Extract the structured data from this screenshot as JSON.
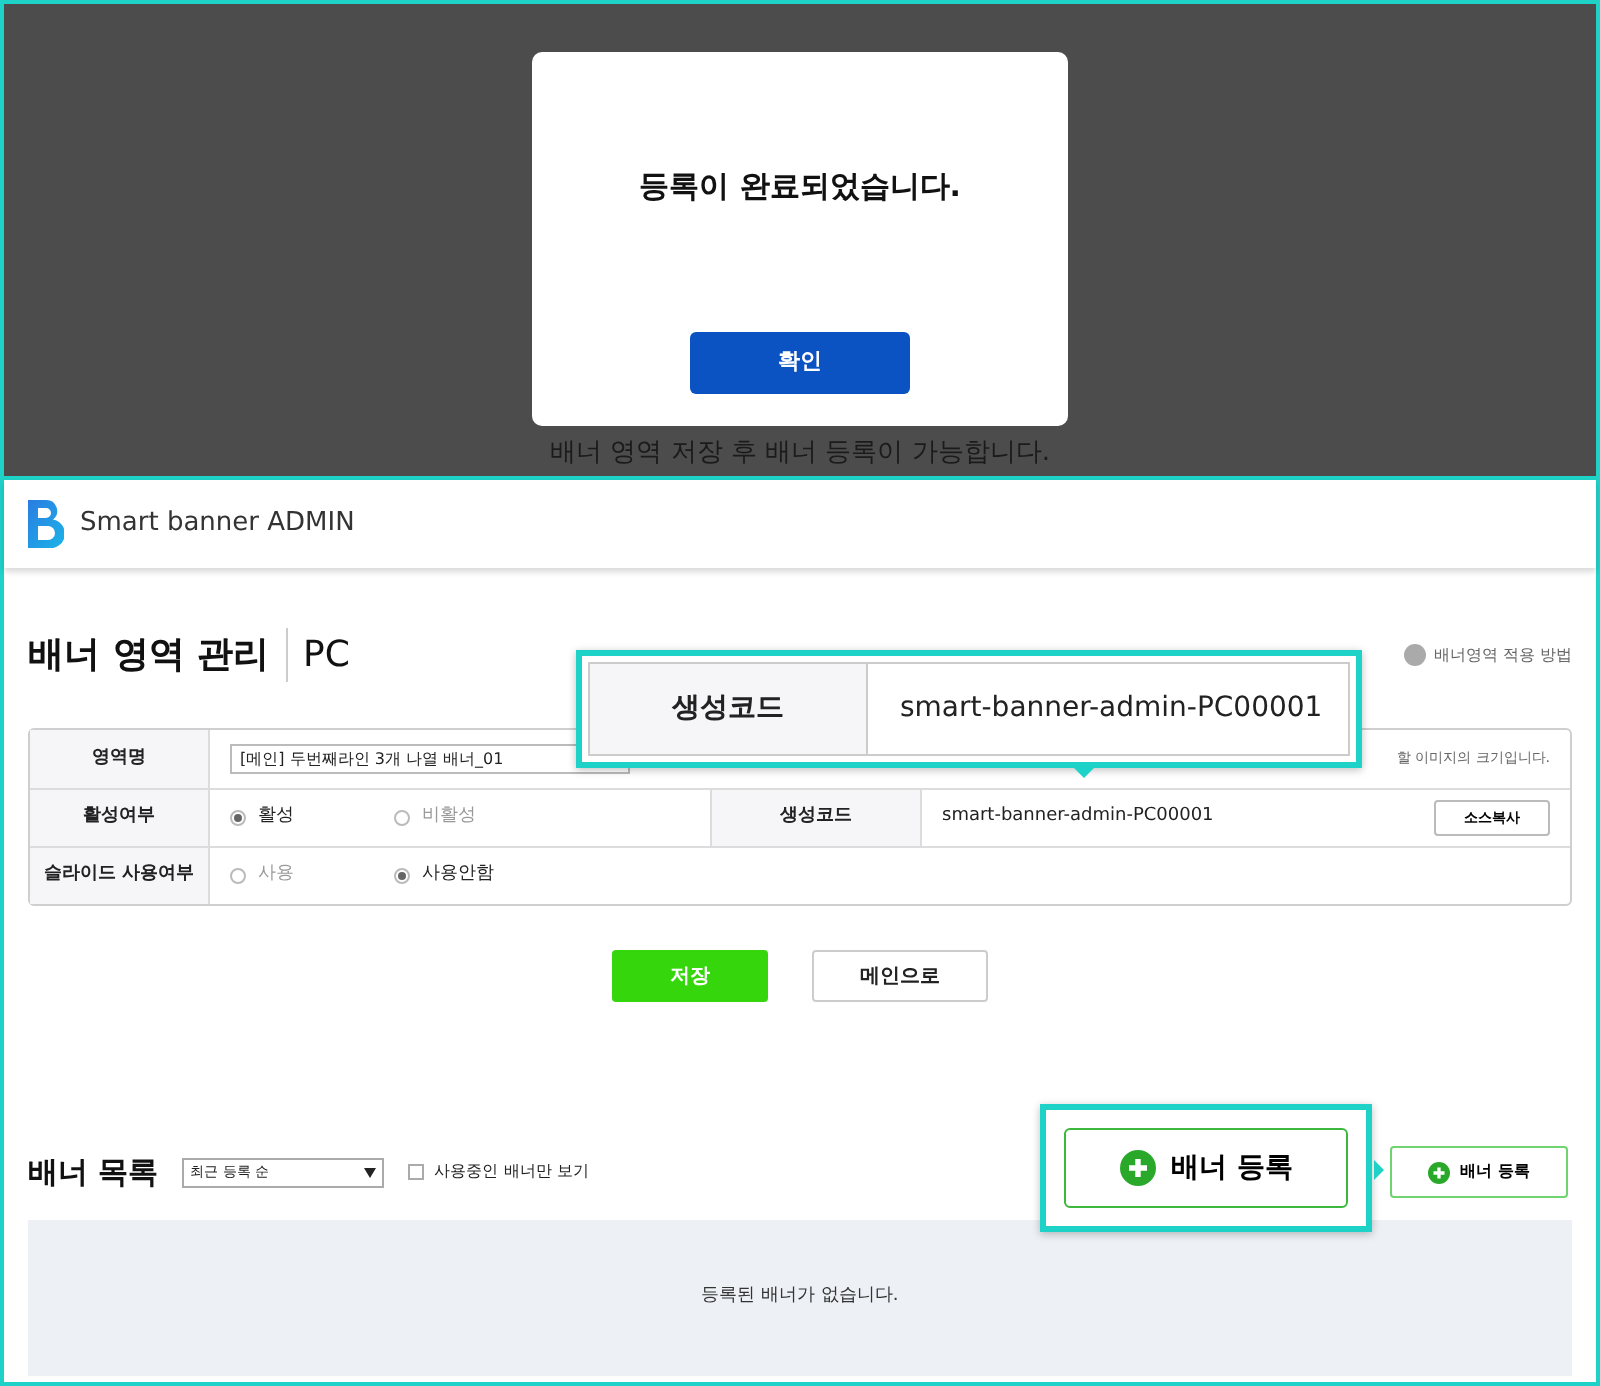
{
  "modal_screen": {
    "dialog": {
      "message": "등록이 완료되었습니다.",
      "confirm_button": "확인"
    },
    "notice": "배너 영역 저장 후 배너 등록이 가능합니다."
  },
  "admin_screen": {
    "logo_text": "Smart banner ADMIN",
    "page_title": "배너 영역 관리",
    "page_subtitle": "PC",
    "help_link": "배너영역 적용 방법",
    "form": {
      "area_name": {
        "label": "영역명",
        "value": "[메인] 두번째라인 3개 나열 배너_01",
        "note": "할 이미지의 크기입니다."
      },
      "active": {
        "label": "활성여부",
        "options": [
          {
            "label": "활성",
            "selected": true
          },
          {
            "label": "비활성",
            "selected": false
          }
        ]
      },
      "code": {
        "label": "생성코드",
        "value": "smart-banner-admin-PC00001",
        "button": "소스복사"
      },
      "slide": {
        "label": "슬라이드 사용여부",
        "options": [
          {
            "label": "사용",
            "selected": false
          },
          {
            "label": "사용안함",
            "selected": true
          }
        ]
      }
    },
    "buttons": [
      {
        "label": "저장",
        "kind": "primary"
      },
      {
        "label": "메인으로",
        "kind": "secondary"
      }
    ],
    "banner_list": {
      "title": "배너 목록",
      "sort": "최근 등록 순",
      "only_active": {
        "label": "사용중인 배너만 보기",
        "checked": false
      },
      "register_button": "배너 등록",
      "empty_message": "등록된 배너가 없습니다."
    }
  },
  "callouts": [
    {
      "kind": "code",
      "label": "생성코드",
      "value": "smart-banner-admin-PC00001"
    },
    {
      "kind": "button",
      "label": "배너 등록"
    }
  ]
}
